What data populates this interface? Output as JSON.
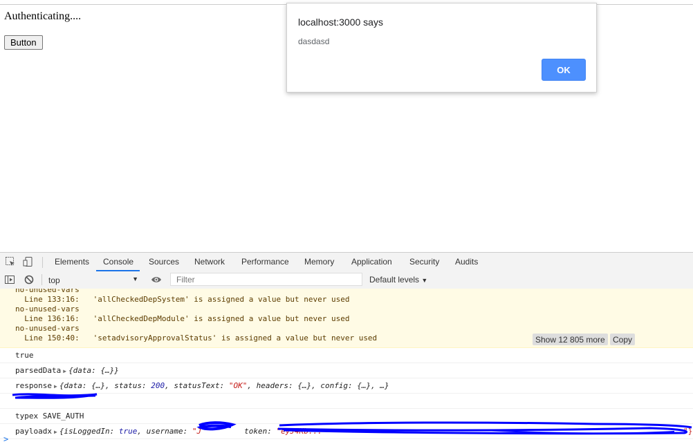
{
  "page": {
    "status_text": "Authenticating....",
    "button_label": "Button"
  },
  "alert": {
    "title": "localhost:3000 says",
    "message": "dasdasd",
    "ok_label": "OK"
  },
  "devtools": {
    "tabs": [
      "Elements",
      "Console",
      "Sources",
      "Network",
      "Performance",
      "Memory",
      "Application",
      "Security",
      "Audits"
    ],
    "active_tab": "Console",
    "toolbar": {
      "context": "top",
      "filter_placeholder": "Filter",
      "levels_label": "Default levels"
    }
  },
  "console": {
    "warnings": [
      "no-unused-vars",
      "  Line 133:16:   'allCheckedDepSystem' is assigned a value but never used",
      "no-unused-vars",
      "  Line 136:16:   'allCheckedDepModule' is assigned a value but never used",
      "no-unused-vars",
      "  Line 150:40:   'setadvisoryApprovalStatus' is assigned a value but never used"
    ],
    "show_more_label": "Show 12 805 more",
    "copy_label": "Copy",
    "entries": {
      "true_value": "true",
      "parsed_label": "parsedData",
      "parsed_value": "{data: {…}}",
      "response_label": "response",
      "response_prefix": "{data: {…}, status: ",
      "response_status": "200",
      "response_mid": ", statusText: ",
      "response_statustext": "\"OK\"",
      "response_suffix": ", headers: {…}, config: {…}, …}",
      "typex_line": "typex SAVE_AUTH",
      "payload_label": "payloadx",
      "payload_prefix": "{isLoggedIn: ",
      "payload_true": "true",
      "payload_mid": ", username: ",
      "payload_user": "\"J",
      "payload_token_label": "token: ",
      "payload_token": "\"eyJ4Kb...",
      "payload_end": "\"}"
    },
    "prompt_symbol": ">"
  },
  "colors": {
    "accent": "#1a73e8",
    "alert_ok": "#4d90fe",
    "warning_bg": "#fffbe5",
    "scribble": "#0000ff"
  }
}
